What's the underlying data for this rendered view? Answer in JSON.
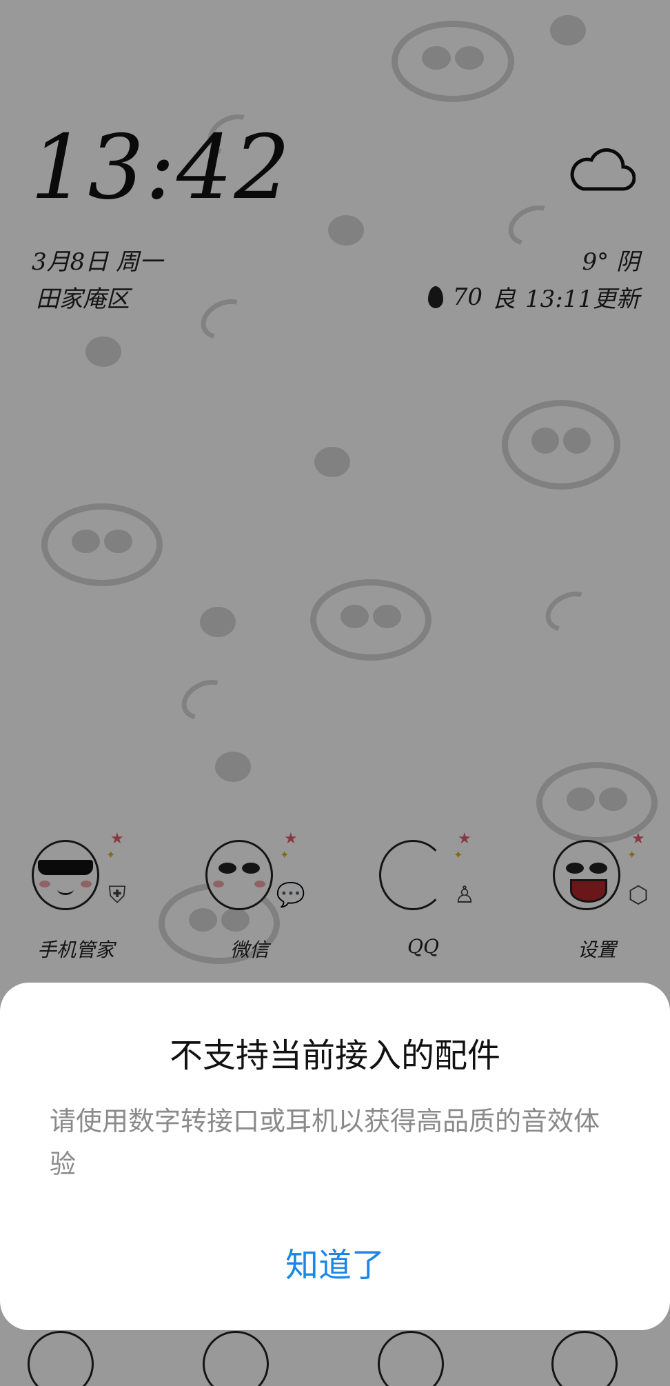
{
  "lockscreen": {
    "time": "13:42",
    "date": "3月8日 周一",
    "district": "田家庵区",
    "weather": {
      "temperature": "9°",
      "condition": "阴",
      "icon": "cloud-icon"
    },
    "air_quality": {
      "index": "70",
      "level": "良",
      "updated": "13:11更新",
      "icon": "leaf-icon"
    }
  },
  "apps": [
    {
      "label": "手机管家",
      "badge_icon": "shield-plus-icon"
    },
    {
      "label": "微信",
      "badge_icon": "wechat-bubbles-icon"
    },
    {
      "label": "QQ",
      "badge_icon": "penguin-icon"
    },
    {
      "label": "设置",
      "badge_icon": "hexagon-gear-icon"
    }
  ],
  "dialog": {
    "title": "不支持当前接入的配件",
    "message": "请使用数字转接口或耳机以获得高品质的音效体验",
    "confirm_label": "知道了"
  },
  "colors": {
    "accent": "#1a86e8",
    "message_text": "#8a8a8a",
    "scrim": "rgba(0,0,0,0.40)"
  }
}
